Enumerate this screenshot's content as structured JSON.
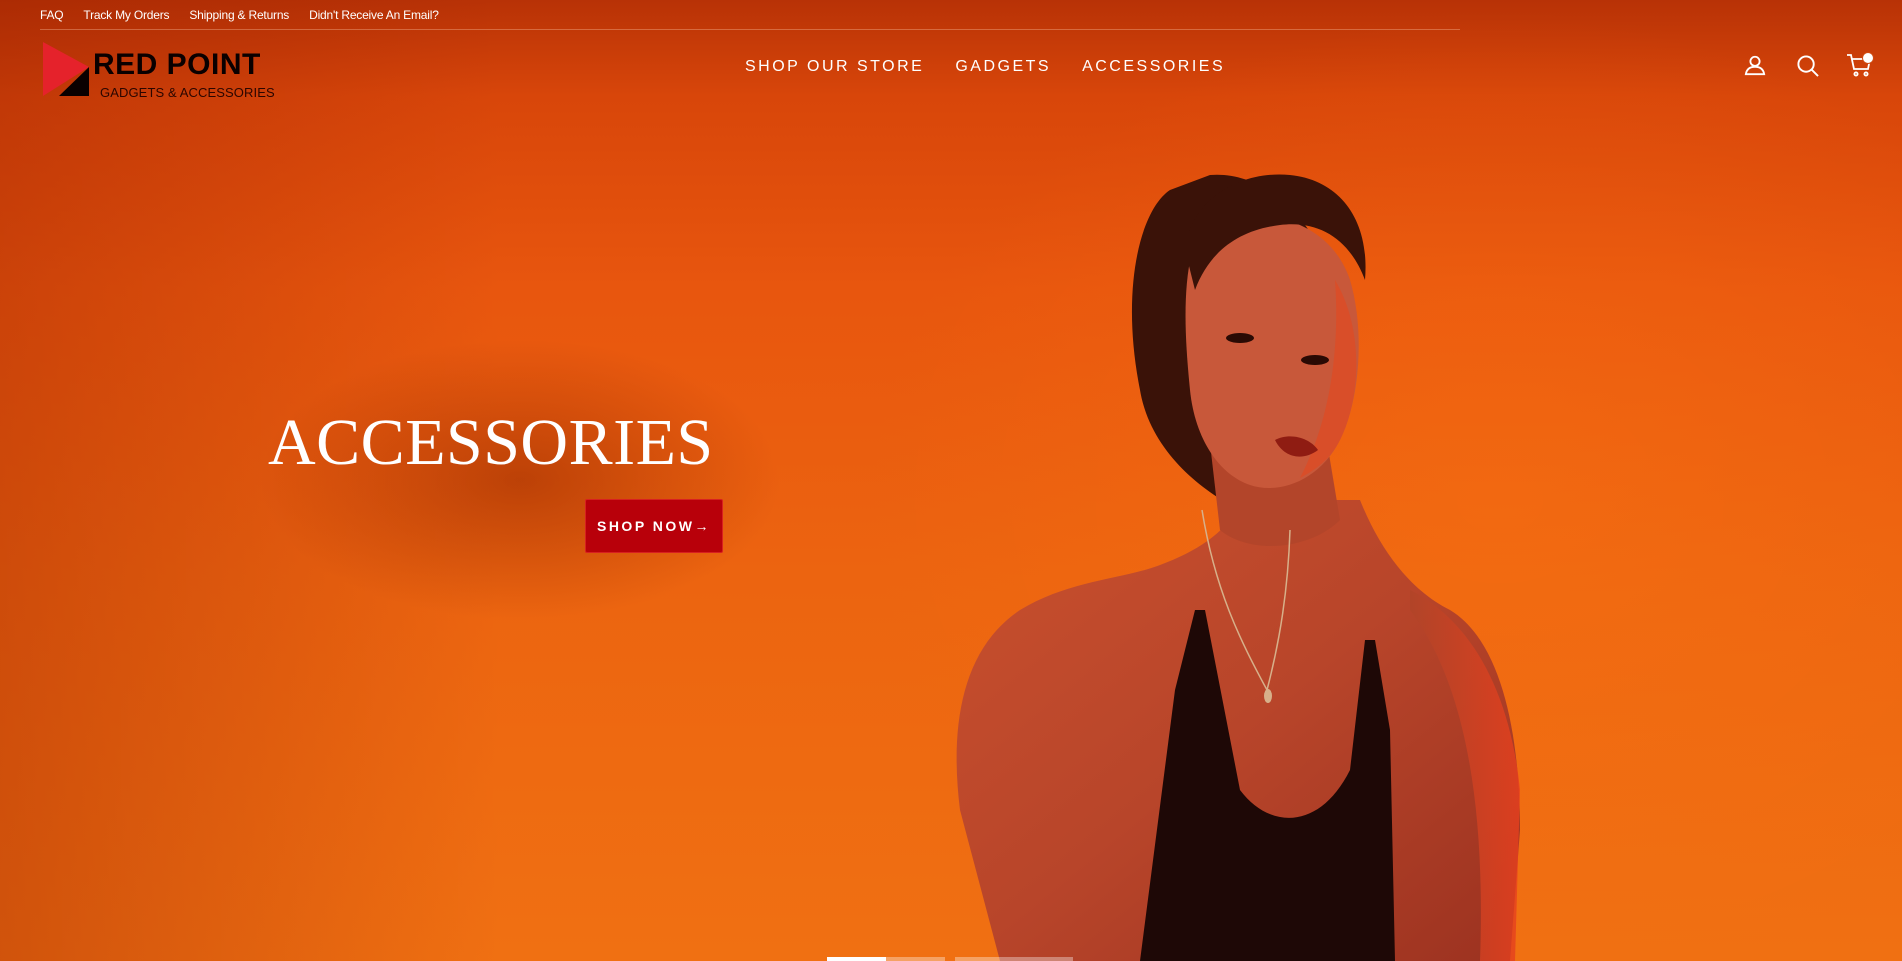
{
  "utility_links": [
    "FAQ",
    "Track My Orders",
    "Shipping & Returns",
    "Didn't Receive An Email?"
  ],
  "brand": {
    "name": "RED POINT",
    "tagline": "GADGETS & ACCESSORIES"
  },
  "nav": [
    "SHOP OUR STORE",
    "GADGETS",
    "ACCESSORIES"
  ],
  "header_icons": [
    "account-icon",
    "search-icon",
    "cart-icon"
  ],
  "hero": {
    "title": "ACCESSORIES",
    "button_label": "SHOP NOW→"
  },
  "slider": {
    "slides": 2,
    "active": 0,
    "active_progress": 0.5
  },
  "colors": {
    "accent": "#b8000a",
    "background": "#e8560e",
    "logo_red": "#e5222b"
  }
}
